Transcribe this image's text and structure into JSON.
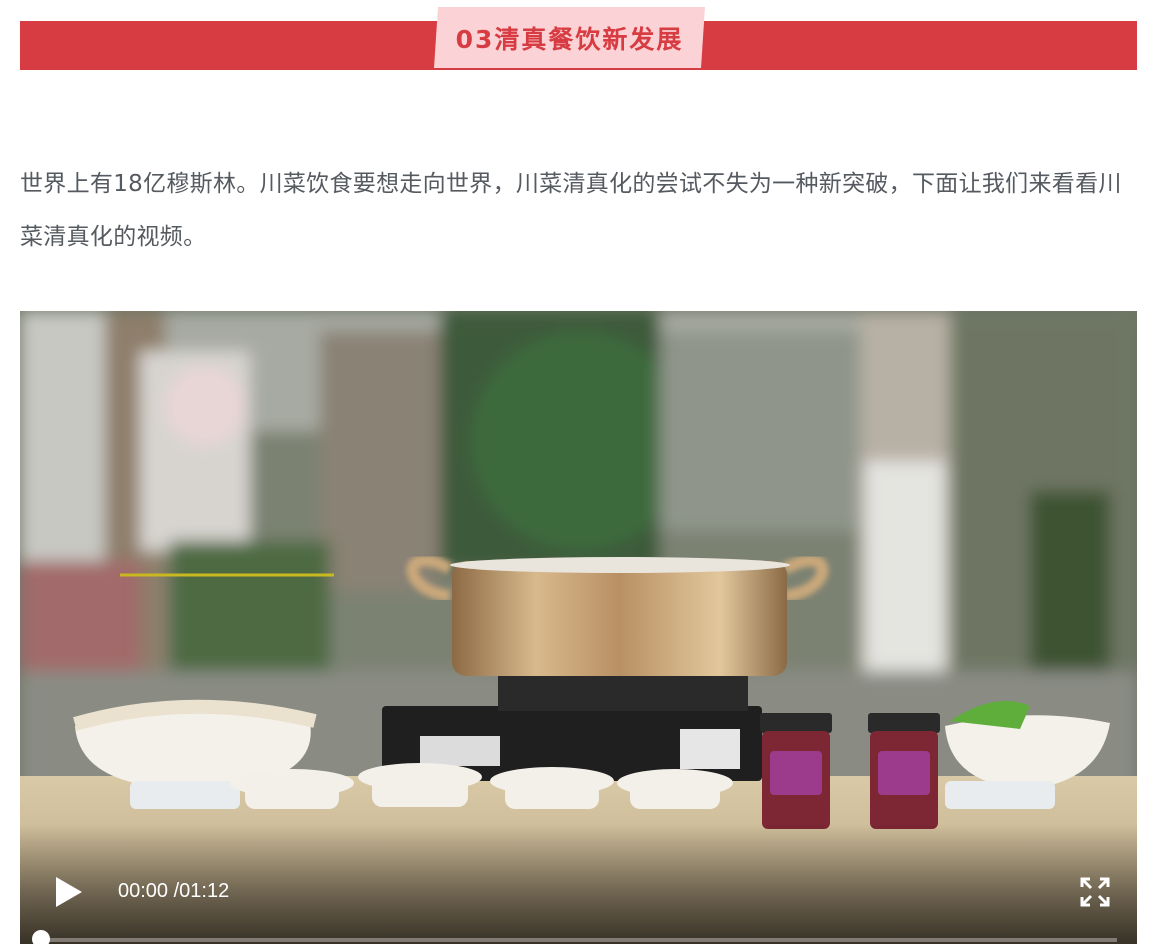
{
  "section": {
    "title": "03清真餐饮新发展",
    "accent_color": "#d83c43",
    "tag_color": "#fbd3d6"
  },
  "article": {
    "paragraph": "世界上有18亿穆斯林。川菜饮食要想走向世界，川菜清真化的尝试不失为一种新突破，下面让我们来看看川菜清真化的视频。"
  },
  "video": {
    "current_time": "00:00",
    "duration": "/01:12",
    "progress": 0,
    "play_icon": "play-icon",
    "fullscreen_icon": "fullscreen-icon"
  }
}
